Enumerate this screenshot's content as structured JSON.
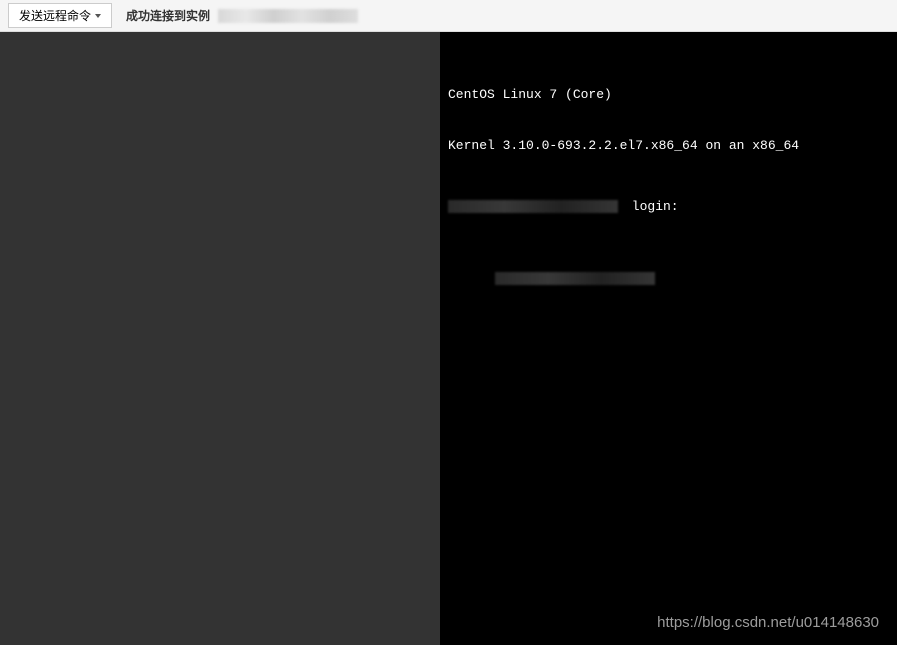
{
  "toolbar": {
    "send_command_label": "发送远程命令",
    "status_label": "成功连接到实例"
  },
  "terminal": {
    "line1": "CentOS Linux 7 (Core)",
    "line2": "Kernel 3.10.0-693.2.2.el7.x86_64 on an x86_64",
    "login_prompt": " login:"
  },
  "watermark": {
    "text": "https://blog.csdn.net/u014148630"
  }
}
